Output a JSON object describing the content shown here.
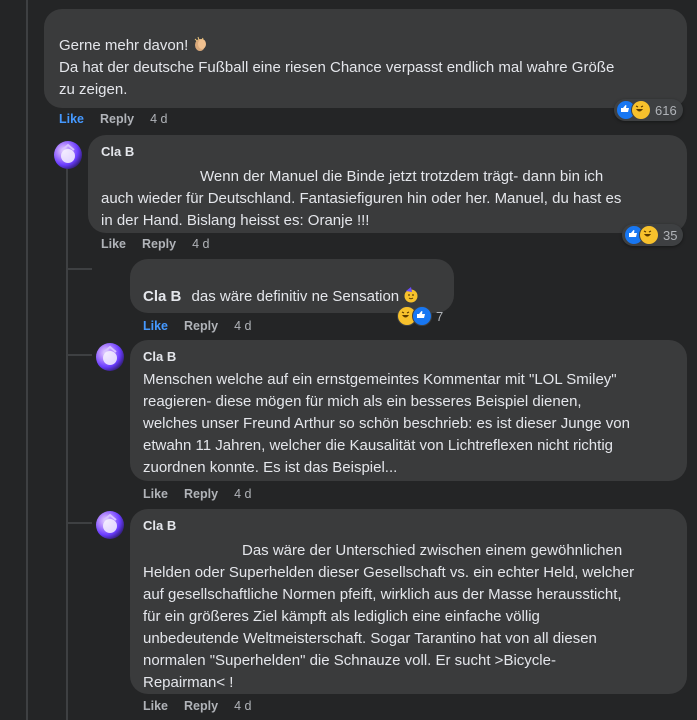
{
  "comments": [
    {
      "text_line1": "Gerne mehr davon!",
      "emoji": "clapping-hands",
      "text_line2": "Da hat der deutsche Fußball eine riesen Chance verpasst endlich mal wahre Größe",
      "text_line3": "zu zeigen.",
      "like": "Like",
      "reply": "Reply",
      "time": "4 d",
      "reaction_count": "616",
      "reactions": [
        "like",
        "haha"
      ]
    },
    {
      "author": "Cla B",
      "lines": [
        "Wenn der Manuel die Binde jetzt trotzdem trägt- dann bin ich",
        "auch wieder für Deutschland. Fantasiefiguren hin oder her. Manuel, du hast es",
        "in der Hand. Bislang heisst es: Oranje !!!"
      ],
      "like": "Like",
      "reply": "Reply",
      "time": "4 d",
      "reaction_count": "35",
      "reactions": [
        "like",
        "haha"
      ]
    },
    {
      "author": "Cla B",
      "text": "das wäre definitiv ne Sensation",
      "emoji": "partying-face",
      "like": "Like",
      "reply": "Reply",
      "time": "4 d",
      "reaction_count": "7",
      "reactions": [
        "haha",
        "like"
      ]
    },
    {
      "author": "Cla B",
      "lines": [
        "Menschen welche auf ein ernstgemeintes Kommentar mit \"LOL Smiley\"",
        "reagieren- diese mögen für mich als ein besseres Beispiel dienen,",
        "welches unser Freund Arthur so schön beschrieb: es ist dieser Junge von",
        "etwahn 11 Jahren, welcher die Kausalität von Lichtreflexen nicht richtig",
        "zuordnen konnte. Es ist das Beispiel..."
      ],
      "like": "Like",
      "reply": "Reply",
      "time": "4 d"
    },
    {
      "author": "Cla B",
      "lines": [
        "Das wäre der Unterschied zwischen einem gewöhnlichen",
        "Helden oder Superhelden dieser Gesellschaft vs. ein echter Held, welcher",
        "auf gesellschaftliche Normen pfeift, wirklich aus der Masse heraussticht,",
        "für ein größeres Ziel kämpft als lediglich eine einfache völlig",
        "unbedeutende Weltmeisterschaft. Sogar Tarantino hat von all diesen",
        "normalen \"Superhelden\" die Schnauze voll. Er sucht >Bicycle-",
        "Repairman< !"
      ],
      "like": "Like",
      "reply": "Reply",
      "time": "4 d"
    }
  ],
  "colors": {
    "background": "#242526",
    "bubble": "#3a3b3c",
    "text": "#e4e6eb",
    "secondary_text": "#b0b3b8",
    "link_blue": "#4599ff",
    "like_blue": "#1877f2",
    "haha_yellow": "#f7c12c"
  }
}
